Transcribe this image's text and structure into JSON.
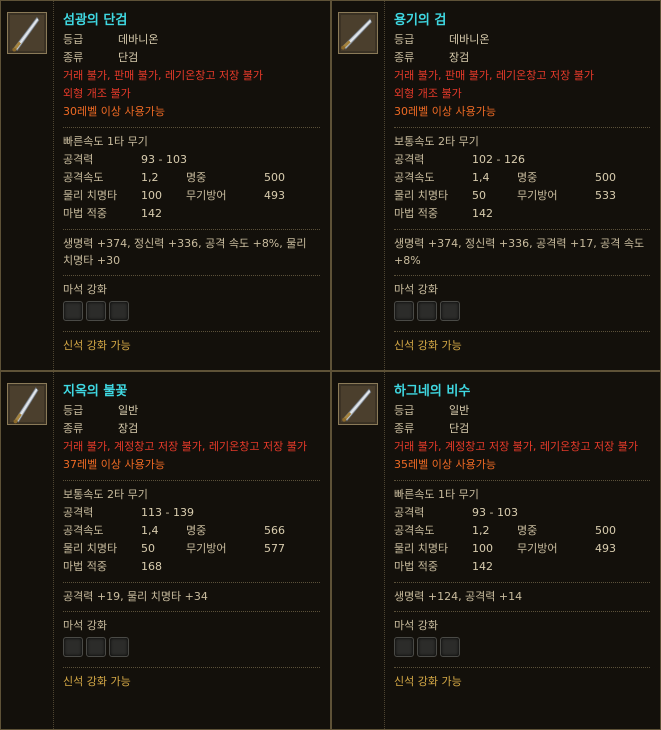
{
  "items": [
    {
      "name": "섬광의 단검",
      "grade_label": "등급",
      "grade": "데바니온",
      "type_label": "종류",
      "type": "단검",
      "restrictions": "거래 불가, 판매 불가, 레기온창고 저장 불가",
      "restrictions2": "외형 개조 불가",
      "level_req": "30레벨 이상 사용가능",
      "weapon_class": "빠른속도 1타 무기",
      "stats": {
        "attack_label": "공격력",
        "attack": "93 - 103",
        "speed_label": "공격속도",
        "speed": "1,2",
        "accuracy_label": "명중",
        "accuracy": "500",
        "crit_label": "물리 치명타",
        "crit": "100",
        "parry_label": "무기방어",
        "parry": "493",
        "magic_label": "마법 적중",
        "magic": "142"
      },
      "bonus": "생명력 +374, 정신력 +336, 공격 속도 +8%, 물리 치명타 +30",
      "manastone_label": "마석 강화",
      "godstone": "신석 강화 가능"
    },
    {
      "name": "용기의 검",
      "grade_label": "등급",
      "grade": "데바니온",
      "type_label": "종류",
      "type": "장검",
      "restrictions": "거래 불가, 판매 불가, 레기온창고 저장 불가",
      "restrictions2": "외형 개조 불가",
      "level_req": "30레벨 이상 사용가능",
      "weapon_class": "보통속도 2타 무기",
      "stats": {
        "attack_label": "공격력",
        "attack": "102 - 126",
        "speed_label": "공격속도",
        "speed": "1,4",
        "accuracy_label": "명중",
        "accuracy": "500",
        "crit_label": "물리 치명타",
        "crit": "50",
        "parry_label": "무기방어",
        "parry": "533",
        "magic_label": "마법 적중",
        "magic": "142"
      },
      "bonus": "생명력 +374, 정신력 +336, 공격력 +17, 공격 속도 +8%",
      "manastone_label": "마석 강화",
      "godstone": "신석 강화 가능"
    },
    {
      "name": "지옥의 불꽃",
      "grade_label": "등급",
      "grade": "일반",
      "type_label": "종류",
      "type": "장검",
      "restrictions": "거래 불가, 계정창고 저장 불가, 레기온창고 저장 불가",
      "restrictions2": "",
      "level_req": "37레벨 이상 사용가능",
      "weapon_class": "보통속도 2타 무기",
      "stats": {
        "attack_label": "공격력",
        "attack": "113 - 139",
        "speed_label": "공격속도",
        "speed": "1,4",
        "accuracy_label": "명중",
        "accuracy": "566",
        "crit_label": "물리 치명타",
        "crit": "50",
        "parry_label": "무기방어",
        "parry": "577",
        "magic_label": "마법 적중",
        "magic": "168"
      },
      "bonus": "공격력 +19, 물리 치명타 +34",
      "manastone_label": "마석 강화",
      "godstone": "신석 강화 가능"
    },
    {
      "name": "하그네의 비수",
      "grade_label": "등급",
      "grade": "일반",
      "type_label": "종류",
      "type": "단검",
      "restrictions": "거래 불가, 계정창고 저장 불가, 레기온창고 저장 불가",
      "restrictions2": "",
      "level_req": "35레벨 이상 사용가능",
      "weapon_class": "빠른속도 1타 무기",
      "stats": {
        "attack_label": "공격력",
        "attack": "93 - 103",
        "speed_label": "공격속도",
        "speed": "1,2",
        "accuracy_label": "명중",
        "accuracy": "500",
        "crit_label": "물리 치명타",
        "crit": "100",
        "parry_label": "무기방어",
        "parry": "493",
        "magic_label": "마법 적중",
        "magic": "142"
      },
      "bonus": "생명력 +124, 공격력 +14",
      "manastone_label": "마석 강화",
      "godstone": "신석 강화 가능"
    }
  ],
  "icons": [
    "dagger-icon",
    "sword-icon",
    "sword-icon",
    "dagger-icon"
  ]
}
